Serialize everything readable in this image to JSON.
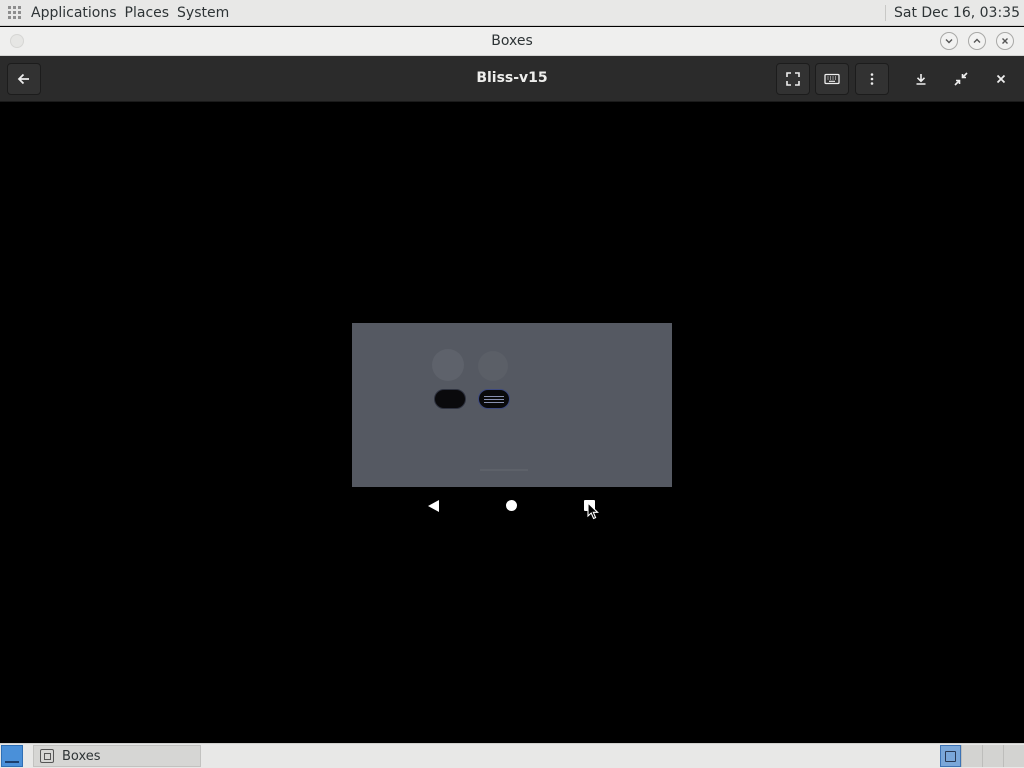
{
  "top_panel": {
    "menus": [
      "Applications",
      "Places",
      "System"
    ],
    "clock": "Sat Dec 16, 03:35"
  },
  "window": {
    "title": "Boxes"
  },
  "headerbar": {
    "title": "Bliss-v15",
    "icons": [
      "back-arrow-icon",
      "fullscreen-icon",
      "keyboard-icon",
      "kebab-menu-icon",
      "download-icon",
      "shrink-icon",
      "close-icon"
    ]
  },
  "taskbar": {
    "task_label": "Boxes",
    "workspace_count": 4,
    "active_workspace": 1
  },
  "colors": {
    "panel_bg": "#e8e8e7",
    "headerbar_bg": "#2b2b2b",
    "vm_bg": "#000000",
    "vm_screen": "#555962"
  }
}
